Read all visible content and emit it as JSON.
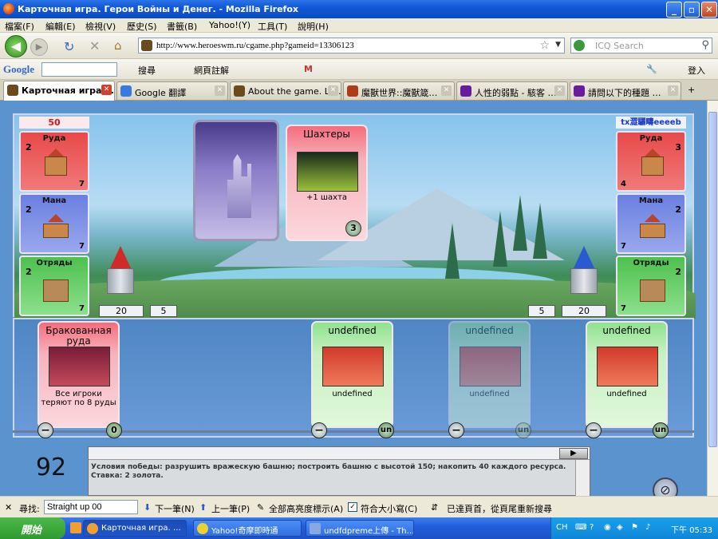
{
  "window": {
    "title": "Карточная игра. Герои Войны и Денег. - Mozilla Firefox"
  },
  "menu": [
    "檔案(F)",
    "編輯(E)",
    "檢視(V)",
    "歷史(S)",
    "書籤(B)",
    "Yahoo!(Y)",
    "工具(T)",
    "說明(H)"
  ],
  "nav": {
    "url": "http://www.heroeswm.ru/cgame.php?gameid=13306123",
    "search_placeholder": "ICQ Search"
  },
  "google_bar": {
    "logo": "Google",
    "search_btn": "搜尋",
    "translate": "網頁註解",
    "login": "登入"
  },
  "tabs": [
    {
      "label": "Карточная игра.…",
      "active": true
    },
    {
      "label": "Google 翻譯"
    },
    {
      "label": "About the game. Lor…"
    },
    {
      "label": "魔獸世界::魔獸箴…"
    },
    {
      "label": "人性的弱點 - 駭客 …"
    },
    {
      "label": "請問以下的種題 …"
    }
  ],
  "game": {
    "player": {
      "score": "50",
      "resources": [
        {
          "name": "Руда",
          "left": "2",
          "right": "7",
          "color": "#e84a4a"
        },
        {
          "name": "Мана",
          "left": "2",
          "right": "7",
          "color": "#6a7fe0"
        },
        {
          "name": "Отряды",
          "left": "2",
          "right": "7",
          "color": "#4ec04e"
        }
      ],
      "tower": "20",
      "wall": "5"
    },
    "enemy": {
      "name": "tx澀驪疇eeeeb",
      "resources": [
        {
          "name": "Руда",
          "left": "4",
          "right": "3"
        },
        {
          "name": "Мана",
          "left": "7",
          "right": "2"
        },
        {
          "name": "Отряды",
          "left": "7",
          "right": "2"
        }
      ],
      "tower": "20",
      "wall": "5"
    },
    "played_card": {
      "title": "Шахтеры",
      "desc": "+1 шахта",
      "cost": "3"
    },
    "hand": [
      {
        "title": "Бракованная руда",
        "desc": "Все игроки теряют по 8 руды",
        "cost": "0"
      },
      {
        "title": "undefined",
        "desc": "undefined",
        "cost": "un"
      },
      {
        "title": "undefined",
        "desc": "undefined",
        "cost": "un"
      },
      {
        "title": "undefined",
        "desc": "undefined",
        "cost": "un"
      }
    ],
    "turn": "92",
    "log": "Условия победы: разрушить вражескую башню; построить башню с высотой 150; накопить 40 каждого ресурса. Ставка: 2 золота."
  },
  "findbar": {
    "label": "尋找:",
    "value": "Straight up 00",
    "next": "下一筆(N)",
    "prev": "上一筆(P)",
    "highlight": "全部高亮度標示(A)",
    "match": "符合大小寫(C)",
    "status": "已達頁首，從頁尾重新搜尋"
  },
  "taskbar": {
    "start": "開始",
    "items": [
      "Карточная игра. …",
      "Yahoo!奇摩即時通",
      "undfdpreme上傳 - Th…"
    ],
    "lang": "CH",
    "clock": "下午 05:33"
  }
}
